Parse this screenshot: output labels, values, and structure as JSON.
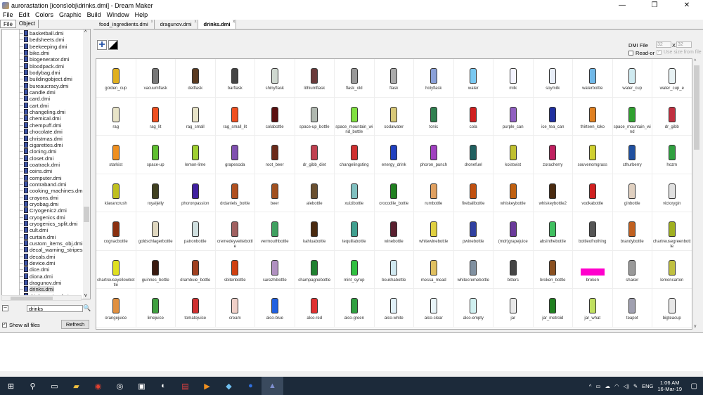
{
  "window": {
    "title": "aurorastation [icons\\obj\\drinks.dmi] - Dream Maker",
    "minimize": "—",
    "maximize": "❐",
    "close": "✕"
  },
  "menu": [
    "File",
    "Edit",
    "Colors",
    "Graphic",
    "Build",
    "Window",
    "Help"
  ],
  "left_panel": {
    "tabs": [
      "File",
      "Object"
    ],
    "files": [
      "basketball.dmi",
      "bedsheets.dmi",
      "beekeeping.dmi",
      "bike.dmi",
      "biogenerator.dmi",
      "bloodpack.dmi",
      "bodybag.dmi",
      "buildingobject.dmi",
      "bureaucracy.dmi",
      "candle.dmi",
      "card.dmi",
      "cart.dmi",
      "changeling.dmi",
      "chemical.dmi",
      "chempuff.dmi",
      "chocolate.dmi",
      "christmas.dmi",
      "cigarettes.dmi",
      "cloning.dmi",
      "closet.dmi",
      "coatrack.dmi",
      "coins.dmi",
      "computer.dmi",
      "contraband.dmi",
      "cooking_machines.dmi",
      "crayons.dmi",
      "cryobag.dmi",
      "Cryogenic2.dmi",
      "cryogenics.dmi",
      "cryogenics_split.dmi",
      "cult.dmi",
      "curtain.dmi",
      "custom_items_obj.dmi",
      "decal_warning_stripes.dmi",
      "decals.dmi",
      "device.dmi",
      "dice.dmi",
      "diona.dmi",
      "dragunov.dmi",
      "drinks.dmi",
      "drinks_extra.dmi"
    ],
    "selected": "drinks.dmi",
    "filter_value": "drinks",
    "show_all_files": "Show all files",
    "show_all_checked": true,
    "refresh": "Refresh"
  },
  "tabs": [
    {
      "label": "food_ingredients.dmi",
      "active": false
    },
    {
      "label": "dragunov.dmi",
      "active": false
    },
    {
      "label": "drinks.dmi",
      "active": true
    }
  ],
  "editor": {
    "dmi_label": "DMI File",
    "width": "32",
    "height": "32",
    "x_sep": "X",
    "read_only": "Read-or",
    "use_size": "Use size from file",
    "icons": [
      {
        "n": "golden_cup",
        "c": "#e0b020"
      },
      {
        "n": "vacuumflask",
        "c": "#777"
      },
      {
        "n": "detflask",
        "c": "#5a3a20"
      },
      {
        "n": "barflask",
        "c": "#444"
      },
      {
        "n": "shinyflask",
        "c": "#cfd8d0"
      },
      {
        "n": "lithiumflask",
        "c": "#6a3a3a"
      },
      {
        "n": "flask_old",
        "c": "#999"
      },
      {
        "n": "flask",
        "c": "#aaa"
      },
      {
        "n": "holyflask",
        "c": "#8aa0d8"
      },
      {
        "n": "water",
        "c": "#7ac8f0"
      },
      {
        "n": "milk",
        "c": "#f4f4ff"
      },
      {
        "n": "soymilk",
        "c": "#e8eef8"
      },
      {
        "n": "waterbottle",
        "c": "#70b8e8"
      },
      {
        "n": "water_cup",
        "c": "#cfeaf0"
      },
      {
        "n": "water_cup_e",
        "c": "#e8f2f4"
      },
      {
        "n": "rag",
        "c": "#e8e4c8"
      },
      {
        "n": "rag_lit",
        "c": "#f05020"
      },
      {
        "n": "rag_small",
        "c": "#e8e4c8"
      },
      {
        "n": "rag_small_lit",
        "c": "#f05020"
      },
      {
        "n": "colabottle",
        "c": "#5a1010"
      },
      {
        "n": "space-up_bottle",
        "c": "#b0b8b0"
      },
      {
        "n": "space_mountain_wind_bottle",
        "c": "#80e040"
      },
      {
        "n": "sodawater",
        "c": "#d8c878"
      },
      {
        "n": "tonic",
        "c": "#308050"
      },
      {
        "n": "cola",
        "c": "#d02020"
      },
      {
        "n": "purple_can",
        "c": "#9060c0"
      },
      {
        "n": "ice_tea_can",
        "c": "#2030a0"
      },
      {
        "n": "thirteen_loko",
        "c": "#e08020"
      },
      {
        "n": "space_mountain_wind",
        "c": "#30a030"
      },
      {
        "n": "dr_gibb",
        "c": "#c03040"
      },
      {
        "n": "starkist",
        "c": "#f09020"
      },
      {
        "n": "space-up",
        "c": "#60c030"
      },
      {
        "n": "lemon-lime",
        "c": "#a0d030"
      },
      {
        "n": "grapesoda",
        "c": "#8050b0"
      },
      {
        "n": "root_beer",
        "c": "#6a2a1a"
      },
      {
        "n": "dr_gibb_diet",
        "c": "#c04050"
      },
      {
        "n": "changelingsting",
        "c": "#d03030"
      },
      {
        "n": "energy_drink",
        "c": "#2040c0"
      },
      {
        "n": "phoron_punch",
        "c": "#a040c0"
      },
      {
        "n": "dronefuel",
        "c": "#206060"
      },
      {
        "n": "koistwist",
        "c": "#c0c030"
      },
      {
        "n": "zoracherry",
        "c": "#c02060"
      },
      {
        "n": "souvenomgrass",
        "c": "#d0d030"
      },
      {
        "n": "cthurberry",
        "c": "#2050a0"
      },
      {
        "n": "hozm",
        "c": "#30a040"
      },
      {
        "n": "klaxancrush",
        "c": "#c0c020"
      },
      {
        "n": "royaljelly",
        "c": "#404020"
      },
      {
        "n": "phoronpassion",
        "c": "#4020a0"
      },
      {
        "n": "drdaniels_bottle",
        "c": "#b05020"
      },
      {
        "n": "beer",
        "c": "#a05020"
      },
      {
        "n": "alebottle",
        "c": "#6a5030"
      },
      {
        "n": "xuizibottle",
        "c": "#80c0c0"
      },
      {
        "n": "crocodile_bottle",
        "c": "#208020"
      },
      {
        "n": "rumbottle",
        "c": "#e0a060"
      },
      {
        "n": "fireballbottle",
        "c": "#c05010"
      },
      {
        "n": "whiskeybottle",
        "c": "#c06010"
      },
      {
        "n": "whiskeybottle2",
        "c": "#4a2a10"
      },
      {
        "n": "vodkabottle",
        "c": "#d02020"
      },
      {
        "n": "ginbottle",
        "c": "#e0d0c0"
      },
      {
        "n": "victorygin",
        "c": "#e0e0e0"
      },
      {
        "n": "cognacbottle",
        "c": "#8a3010"
      },
      {
        "n": "goldschlagerbottle",
        "c": "#e0d8c0"
      },
      {
        "n": "patronbottle",
        "c": "#d0e0e0"
      },
      {
        "n": "cremedeyvettebottle",
        "c": "#a06060"
      },
      {
        "n": "vermouthbottle",
        "c": "#40a060"
      },
      {
        "n": "kahluabottle",
        "c": "#4a2a10"
      },
      {
        "n": "tequillabottle",
        "c": "#40a090"
      },
      {
        "n": "winebottle",
        "c": "#5a2030"
      },
      {
        "n": "whitewinebottle",
        "c": "#e0d040"
      },
      {
        "n": "pwinebottle",
        "c": "#3040a0"
      },
      {
        "n": "(mdr)grapejuice",
        "c": "#6a3a9a"
      },
      {
        "n": "absinthebottle",
        "c": "#40c060"
      },
      {
        "n": "bottleofnothing",
        "c": "#555"
      },
      {
        "n": "brandybottle",
        "c": "#c06020"
      },
      {
        "n": "chartreusegreenbottle",
        "c": "#a0b020"
      },
      {
        "n": "chartreuseyellowbottle",
        "c": "#e0e020"
      },
      {
        "n": "guinnes_bottle",
        "c": "#3a1a10"
      },
      {
        "n": "drambuie_bottle",
        "c": "#a04020"
      },
      {
        "n": "sbitenbottle",
        "c": "#d04010"
      },
      {
        "n": "sarezhibottle",
        "c": "#b090c0"
      },
      {
        "n": "champagnebottle",
        "c": "#208030"
      },
      {
        "n": "mint_syrup",
        "c": "#30c040"
      },
      {
        "n": "boukhabottle",
        "c": "#d0e8f0"
      },
      {
        "n": "messa_mead",
        "c": "#e0c060"
      },
      {
        "n": "whitecremebottle",
        "c": "#8090a0"
      },
      {
        "n": "bitters",
        "c": "#444"
      },
      {
        "n": "broken_bottle",
        "c": "#8a5020"
      },
      {
        "n": "broken",
        "c": "#ff00cc"
      },
      {
        "n": "shaker",
        "c": "#999"
      },
      {
        "n": "lemoncarton",
        "c": "#c0c040"
      },
      {
        "n": "orangejuice",
        "c": "#e09040"
      },
      {
        "n": "limejuice",
        "c": "#40a040"
      },
      {
        "n": "tomatojuice",
        "c": "#d03030"
      },
      {
        "n": "cream",
        "c": "#f0d0c8"
      },
      {
        "n": "alco-blue",
        "c": "#2060e0"
      },
      {
        "n": "alco-red",
        "c": "#e03030"
      },
      {
        "n": "alco-green",
        "c": "#30a040"
      },
      {
        "n": "alco-white",
        "c": "#e0f0f8"
      },
      {
        "n": "alco-clear",
        "c": "#e8f4f8"
      },
      {
        "n": "alco-empty",
        "c": "#d0f0f0"
      },
      {
        "n": "jar",
        "c": "#e8e8e8"
      },
      {
        "n": "jar_metroid",
        "c": "#208020"
      },
      {
        "n": "jar_what",
        "c": "#c0e060"
      },
      {
        "n": "teapot",
        "c": "#a0a0b0"
      },
      {
        "n": "bigteacup",
        "c": "#e8e8e8"
      }
    ]
  },
  "taskbar": {
    "time": "1:06 AM",
    "date": "16-Mar-19",
    "lang": "ENG"
  }
}
